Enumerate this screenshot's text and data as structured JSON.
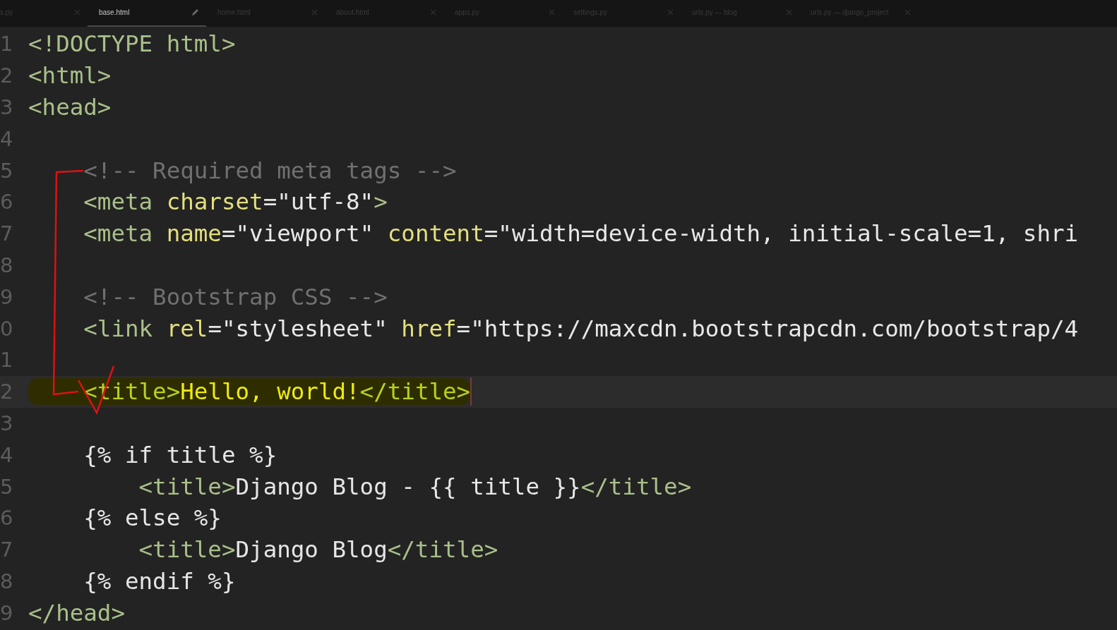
{
  "tabs": [
    {
      "label": "s.py",
      "selected": false,
      "modified": false
    },
    {
      "label": "base.html",
      "selected": true,
      "modified": true
    },
    {
      "label": "home.html",
      "selected": false,
      "modified": false
    },
    {
      "label": "about.html",
      "selected": false,
      "modified": false
    },
    {
      "label": "apps.py",
      "selected": false,
      "modified": false
    },
    {
      "label": "settings.py",
      "selected": false,
      "modified": false
    },
    {
      "label": "urls.py — blog",
      "selected": false,
      "modified": false
    },
    {
      "label": "urls.py — django_project",
      "selected": false,
      "modified": false
    }
  ],
  "lines": [
    {
      "number": "1",
      "highlighted": false,
      "cursor": false,
      "tokens": [
        {
          "kind": "tag",
          "text": "<!DOCTYPE html>"
        }
      ]
    },
    {
      "number": "2",
      "highlighted": false,
      "cursor": false,
      "tokens": [
        {
          "kind": "tag",
          "text": "<html>"
        }
      ]
    },
    {
      "number": "3",
      "highlighted": false,
      "cursor": false,
      "tokens": [
        {
          "kind": "tag",
          "text": "<head>"
        }
      ]
    },
    {
      "number": "4",
      "highlighted": false,
      "cursor": false
    },
    {
      "number": "5",
      "highlighted": false,
      "cursor": false,
      "tokens": [
        {
          "kind": "comment",
          "text": "    <!-- Required meta tags -->"
        }
      ]
    },
    {
      "number": "6",
      "highlighted": false,
      "cursor": false,
      "tokens": [
        {
          "kind": "tag",
          "text": "    <meta "
        },
        {
          "kind": "attr",
          "text": "charset"
        },
        {
          "kind": "text",
          "text": "="
        },
        {
          "kind": "string",
          "text": "\"utf-8\""
        },
        {
          "kind": "tag",
          "text": ">"
        }
      ]
    },
    {
      "number": "7",
      "highlighted": false,
      "cursor": false,
      "tokens": [
        {
          "kind": "tag",
          "text": "    <meta "
        },
        {
          "kind": "attr",
          "text": "name"
        },
        {
          "kind": "text",
          "text": "="
        },
        {
          "kind": "string",
          "text": "\"viewport\" "
        },
        {
          "kind": "attr",
          "text": "content"
        },
        {
          "kind": "text",
          "text": "="
        },
        {
          "kind": "string",
          "text": "\"width=device-width, initial-scale=1, shri"
        }
      ]
    },
    {
      "number": "8",
      "highlighted": false,
      "cursor": false
    },
    {
      "number": "9",
      "highlighted": false,
      "cursor": false,
      "tokens": [
        {
          "kind": "comment",
          "text": "    <!-- Bootstrap CSS -->"
        }
      ]
    },
    {
      "number": "0",
      "highlighted": false,
      "cursor": false,
      "tokens": [
        {
          "kind": "tag",
          "text": "    <link "
        },
        {
          "kind": "attr",
          "text": "rel"
        },
        {
          "kind": "text",
          "text": "="
        },
        {
          "kind": "string",
          "text": "\"stylesheet\" "
        },
        {
          "kind": "attr",
          "text": "href"
        },
        {
          "kind": "text",
          "text": "="
        },
        {
          "kind": "string",
          "text": "\"https://maxcdn.bootstrapcdn.com/bootstrap/4"
        }
      ]
    },
    {
      "number": "1",
      "highlighted": false,
      "cursor": false
    },
    {
      "number": "2",
      "highlighted": true,
      "cursor": true,
      "tokens": [
        {
          "kind": "tag",
          "text": "    <title>"
        },
        {
          "kind": "text",
          "text": "Hello, world!"
        },
        {
          "kind": "tag",
          "text": "</title>"
        }
      ]
    },
    {
      "number": "3",
      "highlighted": false,
      "cursor": false
    },
    {
      "number": "4",
      "highlighted": false,
      "cursor": false,
      "tokens": [
        {
          "kind": "text",
          "text": "    {% if title %}"
        }
      ]
    },
    {
      "number": "5",
      "highlighted": false,
      "cursor": false,
      "tokens": [
        {
          "kind": "tag",
          "text": "        <title>"
        },
        {
          "kind": "text",
          "text": "Django Blog - {{ title }}"
        },
        {
          "kind": "tag",
          "text": "</title>"
        }
      ]
    },
    {
      "number": "6",
      "highlighted": false,
      "cursor": false,
      "tokens": [
        {
          "kind": "text",
          "text": "    {% else %}"
        }
      ]
    },
    {
      "number": "7",
      "highlighted": false,
      "cursor": false,
      "tokens": [
        {
          "kind": "tag",
          "text": "        <title>"
        },
        {
          "kind": "text",
          "text": "Django Blog"
        },
        {
          "kind": "tag",
          "text": "</title>"
        }
      ]
    },
    {
      "number": "8",
      "highlighted": false,
      "cursor": false,
      "tokens": [
        {
          "kind": "text",
          "text": "    {% endif %}"
        }
      ]
    },
    {
      "number": "9",
      "highlighted": false,
      "cursor": false,
      "tokens": [
        {
          "kind": "tag",
          "text": "</head>"
        }
      ]
    }
  ]
}
